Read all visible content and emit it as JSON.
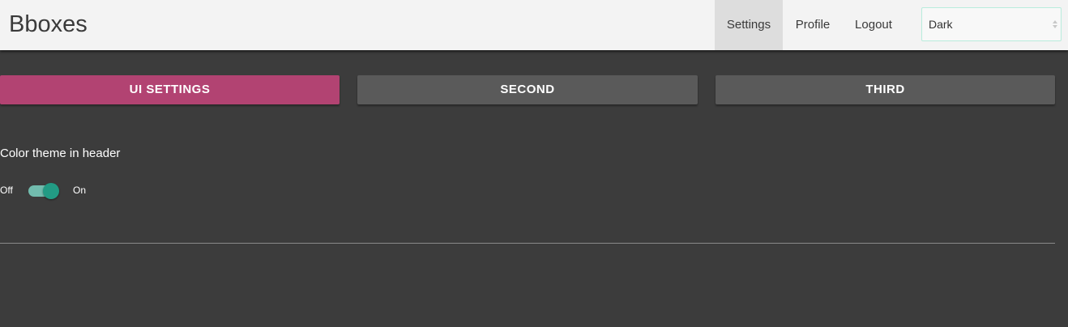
{
  "header": {
    "brand": "Bboxes",
    "nav": {
      "settings": "Settings",
      "profile": "Profile",
      "logout": "Logout"
    },
    "theme_select": {
      "value": "Dark",
      "icon": "select-arrows-icon"
    }
  },
  "tabs": [
    {
      "label": "UI SETTINGS",
      "active": true
    },
    {
      "label": "SECOND",
      "active": false
    },
    {
      "label": "THIRD",
      "active": false
    }
  ],
  "settings": {
    "color_theme": {
      "title": "Color theme in header",
      "off_label": "Off",
      "on_label": "On",
      "enabled": true
    }
  },
  "colors": {
    "background": "#3c3c3c",
    "header_bg": "#f3f3f3",
    "active_tab": "#b24372",
    "inactive_tab": "#5a5a5a",
    "toggle_on": "#229b84",
    "toggle_track": "#72bcae"
  }
}
